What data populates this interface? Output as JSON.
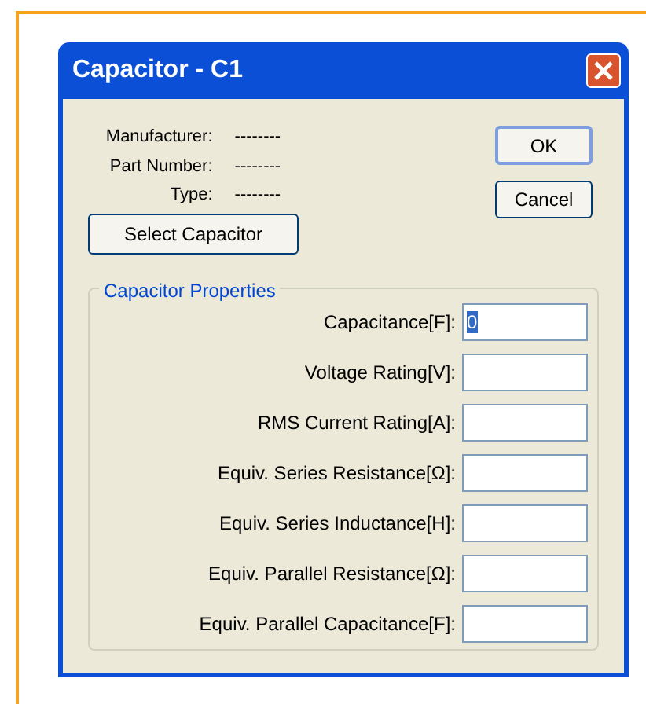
{
  "window": {
    "title": "Capacitor - C1"
  },
  "info": [
    {
      "label": "Manufacturer:",
      "value": "--------"
    },
    {
      "label": "Part Number:",
      "value": "--------"
    },
    {
      "label": "Type:",
      "value": "--------"
    }
  ],
  "buttons": [
    {
      "label": "OK",
      "default": true
    },
    {
      "label": "Cancel",
      "default": false
    }
  ],
  "select_button": {
    "label": "Select Capacitor"
  },
  "group": {
    "title": "Capacitor Properties",
    "fields": [
      {
        "label": "Capacitance[F]:",
        "value": "0",
        "selected": true
      },
      {
        "label": "Voltage Rating[V]:",
        "selected": false
      },
      {
        "label": "RMS Current Rating[A]:",
        "selected": false
      },
      {
        "label": "Equiv. Series Resistance[Ω]:",
        "selected": false
      },
      {
        "label": "Equiv. Series Inductance[H]:",
        "selected": false
      },
      {
        "label": "Equiv. Parallel Resistance[Ω]:",
        "selected": false
      },
      {
        "label": "Equiv. Parallel Capacitance[F]:",
        "selected": false
      }
    ]
  }
}
